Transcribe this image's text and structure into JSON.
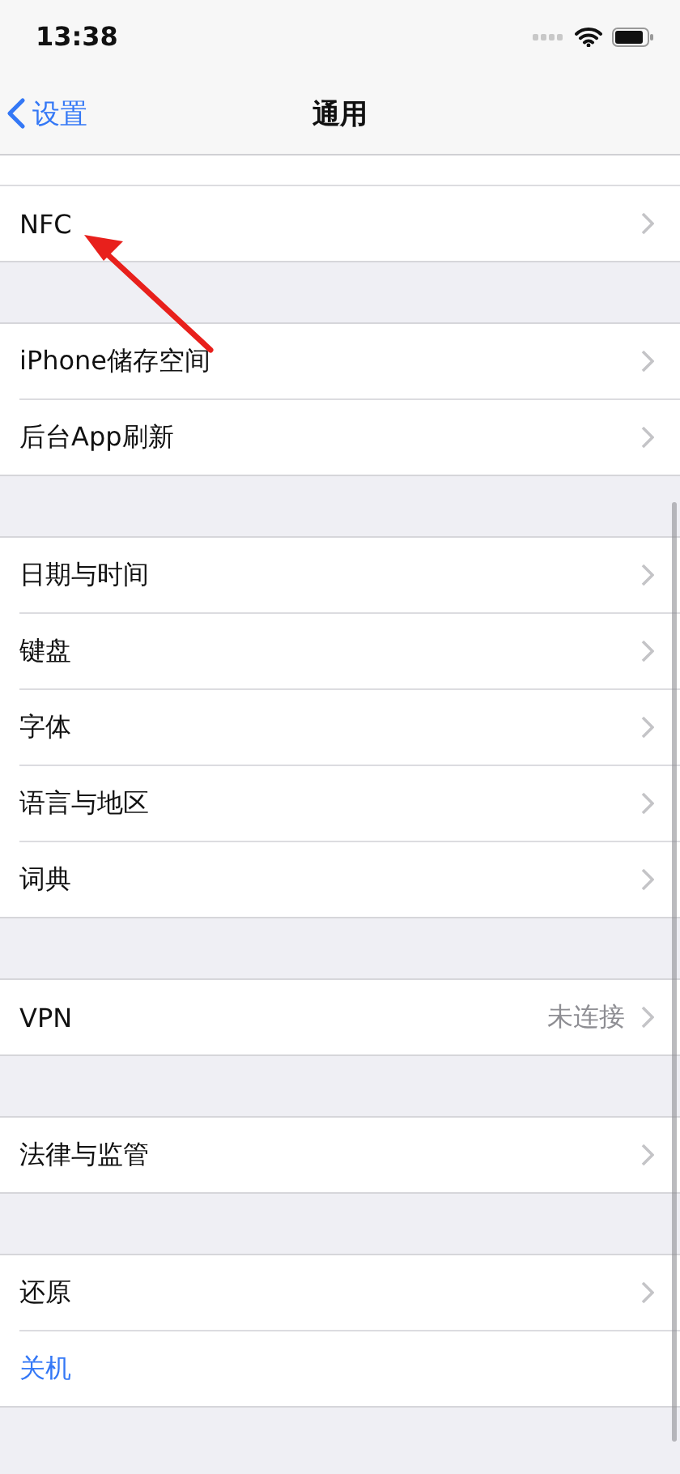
{
  "status_bar": {
    "time": "13:38"
  },
  "nav_bar": {
    "back_label": "设置",
    "title": "通用"
  },
  "groups": [
    {
      "items": [
        {
          "kind": "disclosure",
          "label": "NFC"
        }
      ]
    },
    {
      "items": [
        {
          "kind": "disclosure",
          "label": "iPhone储存空间"
        },
        {
          "kind": "disclosure",
          "label": "后台App刷新"
        }
      ]
    },
    {
      "items": [
        {
          "kind": "disclosure",
          "label": "日期与时间"
        },
        {
          "kind": "disclosure",
          "label": "键盘"
        },
        {
          "kind": "disclosure",
          "label": "字体"
        },
        {
          "kind": "disclosure",
          "label": "语言与地区"
        },
        {
          "kind": "disclosure",
          "label": "词典"
        }
      ]
    },
    {
      "items": [
        {
          "kind": "disclosure",
          "label": "VPN",
          "value": "未连接"
        }
      ]
    },
    {
      "items": [
        {
          "kind": "disclosure",
          "label": "法律与监管"
        }
      ]
    },
    {
      "items": [
        {
          "kind": "disclosure",
          "label": "还原"
        },
        {
          "kind": "action",
          "label": "关机"
        }
      ]
    }
  ]
}
